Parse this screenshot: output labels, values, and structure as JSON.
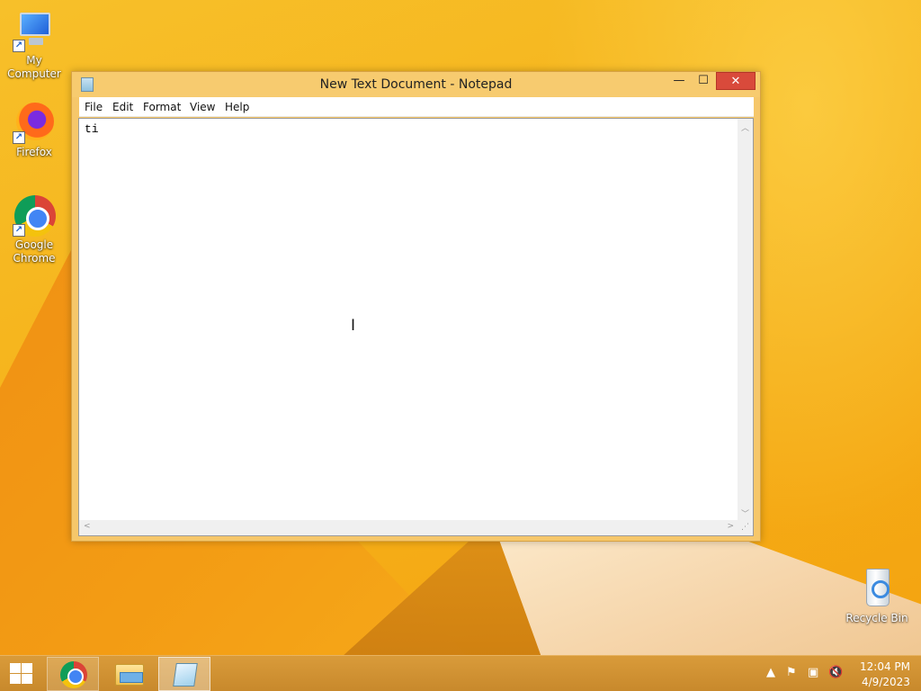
{
  "desktop": {
    "icons": [
      {
        "label": "My Computer"
      },
      {
        "label": "Firefox"
      },
      {
        "label": "Google Chrome"
      },
      {
        "label": "Recycle Bin"
      }
    ]
  },
  "window": {
    "title": "New Text Document - Notepad",
    "controls": {
      "minimize": "—",
      "maximize": "☐",
      "close": "✕"
    },
    "menu": [
      "File",
      "Edit",
      "Format",
      "View",
      "Help"
    ],
    "content": "ti",
    "cursor_glyph": "I"
  },
  "taskbar": {
    "pinned": [
      {
        "name": "Google Chrome",
        "active": false
      },
      {
        "name": "File Explorer",
        "active": false
      },
      {
        "name": "Notepad",
        "active": true
      }
    ],
    "tray": {
      "time": "12:04 PM",
      "date": "4/9/2023",
      "icons": [
        "show-hidden-icons",
        "action-center-flag",
        "network",
        "volume-muted"
      ]
    }
  },
  "colors": {
    "titlebar": "#f7cb6f",
    "close_button": "#d94a3b",
    "taskbar": "#d99b3a"
  }
}
